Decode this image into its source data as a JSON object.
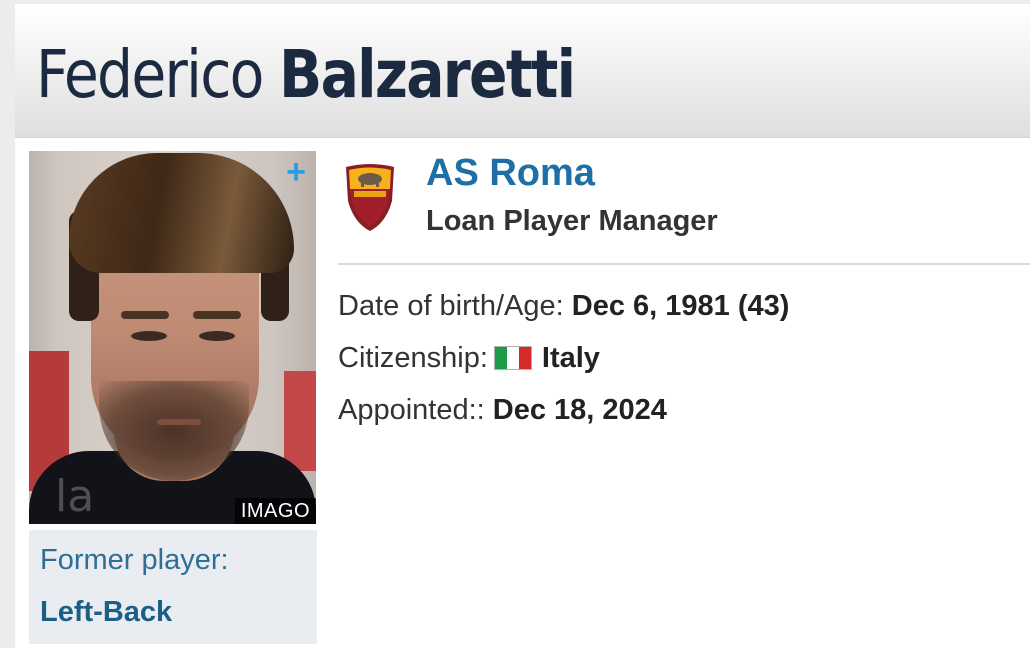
{
  "header": {
    "first_name": "Federico",
    "last_name": "Balzaretti"
  },
  "photo": {
    "credit": "IMAGO",
    "watermark": "la",
    "add_icon": "plus-icon"
  },
  "role_box": {
    "label": "Former player:",
    "position": "Left-Back"
  },
  "club": {
    "name": "AS Roma",
    "logo_icon": "as-roma-crest",
    "role": "Loan Player Manager"
  },
  "info": {
    "dob_label": "Date of birth/Age:",
    "dob_value": "Dec 6, 1981 (43)",
    "citizenship_label": "Citizenship:",
    "citizenship_flag": "italy-flag-icon",
    "citizenship_value": "Italy",
    "appointed_label": "Appointed::",
    "appointed_value": "Dec 18, 2024"
  },
  "colors": {
    "club_link": "#1d6fa5",
    "role_text": "#1b5f87",
    "plus_icon": "#2a9ee0",
    "header_text": "#1b2a40"
  }
}
